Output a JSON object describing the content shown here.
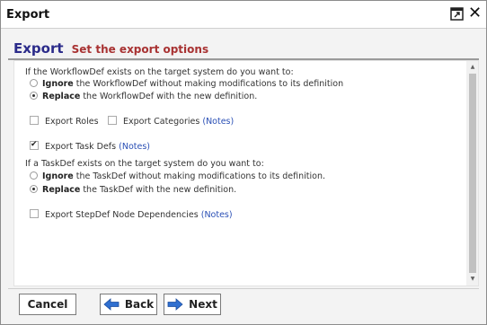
{
  "window": {
    "title": "Export"
  },
  "header": {
    "title": "Export",
    "subtitle": "Set the export options"
  },
  "workflowdef": {
    "question": "If the WorkflowDef exists on the target system do you want to:",
    "ignore_bold": "Ignore",
    "ignore_rest": " the WorkflowDef without making modifications to its definition",
    "replace_bold": "Replace",
    "replace_rest": " the WorkflowDef with the new definition.",
    "selected": "replace"
  },
  "options": {
    "export_roles": {
      "label": "Export Roles",
      "checked": false
    },
    "export_categories": {
      "label": "Export Categories",
      "notes": "(Notes)",
      "checked": false
    },
    "export_task_defs": {
      "label": "Export Task Defs",
      "notes": "(Notes)",
      "checked": true
    },
    "export_stepdef": {
      "label": "Export StepDef Node Dependencies",
      "notes": "(Notes)",
      "checked": false
    }
  },
  "taskdef": {
    "question": "If a TaskDef exists on the target system do you want to:",
    "ignore_bold": "Ignore",
    "ignore_rest": " the TaskDef without making modifications to its definition.",
    "replace_bold": "Replace",
    "replace_rest": " the TaskDef with the new definition.",
    "selected": "replace"
  },
  "buttons": {
    "cancel": "Cancel",
    "back": "Back",
    "next": "Next"
  },
  "colors": {
    "header_title": "#2b2b8a",
    "header_subtitle": "#a83232",
    "link": "#2a4fb5",
    "arrow": "#2f6fd0"
  }
}
